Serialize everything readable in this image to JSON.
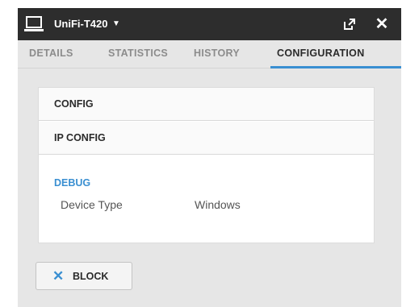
{
  "window": {
    "title": "UniFi-T420",
    "title_caret": "▼",
    "device_icon": "laptop-icon",
    "popout_icon": "popout-icon",
    "close_icon": "close-icon",
    "close_glyph": "✕"
  },
  "tabs": [
    {
      "label": "DETAILS",
      "active": false
    },
    {
      "label": "STATISTICS",
      "active": false
    },
    {
      "label": "HISTORY",
      "active": false
    },
    {
      "label": "CONFIGURATION",
      "active": true
    }
  ],
  "configuration": {
    "sections": [
      {
        "label": "CONFIG"
      },
      {
        "label": "IP CONFIG"
      }
    ],
    "debug": {
      "label": "DEBUG",
      "fields": [
        {
          "key": "Device Type",
          "value": "Windows"
        }
      ]
    }
  },
  "actions": {
    "block_icon": "x-icon",
    "block_glyph": "✕",
    "block_label": "BLOCK"
  },
  "colors": {
    "titlebar": "#2d2d2d",
    "accent": "#3a8fd1",
    "background": "#e6e6e6"
  }
}
